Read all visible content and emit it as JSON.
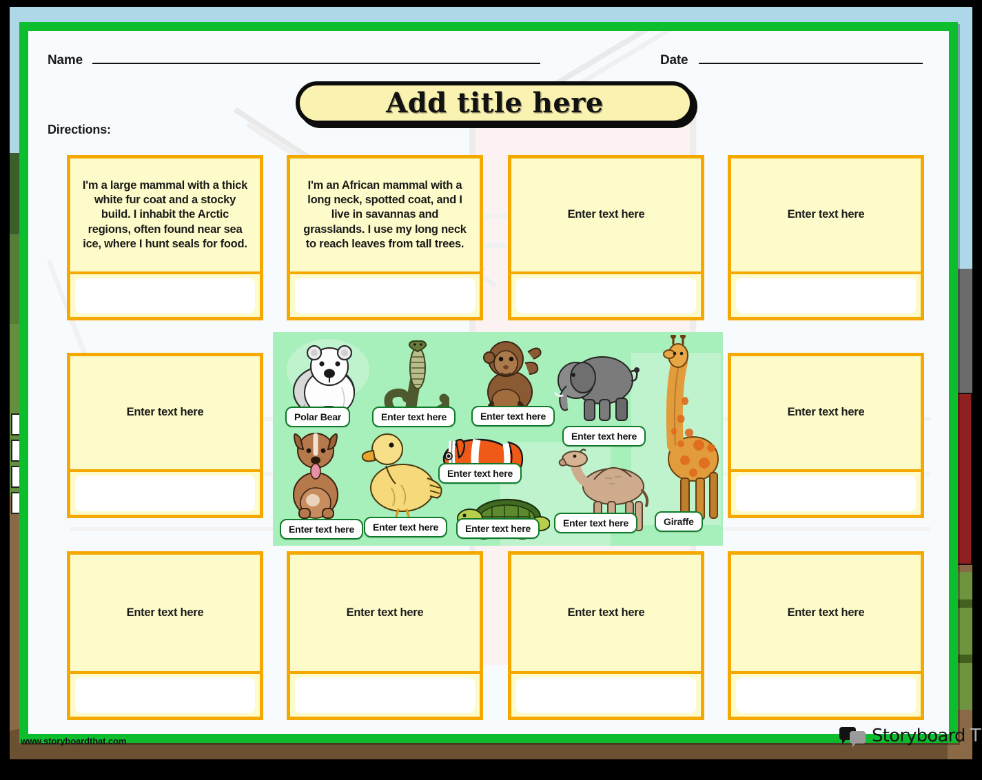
{
  "header": {
    "name_label": "Name",
    "date_label": "Date",
    "title": "Add title here",
    "directions_label": "Directions:"
  },
  "placeholders": {
    "card_text": "Enter text here",
    "tag_text": "Enter text here"
  },
  "cards": [
    {
      "id": "card-1",
      "text": "I'm a large mammal with a thick white fur coat and a stocky build. I inhabit the Arctic regions, often found near sea ice, where I hunt seals for food.",
      "filled": true
    },
    {
      "id": "card-2",
      "text": "I'm an African mammal with a long neck, spotted coat, and I live in savannas and grasslands. I use my long neck to reach leaves from tall trees.",
      "filled": true
    },
    {
      "id": "card-3",
      "text": "Enter text here",
      "filled": false
    },
    {
      "id": "card-4",
      "text": "Enter text here",
      "filled": false
    },
    {
      "id": "card-5",
      "text": "Enter text here",
      "filled": false
    },
    {
      "id": "card-6",
      "text": "Enter text here",
      "filled": false
    },
    {
      "id": "card-7",
      "text": "Enter text here",
      "filled": false
    },
    {
      "id": "card-8",
      "text": "Enter text here",
      "filled": false
    },
    {
      "id": "card-9",
      "text": "Enter text here",
      "filled": false
    },
    {
      "id": "card-10",
      "text": "Enter text here",
      "filled": false
    }
  ],
  "animal_scene": {
    "animals": [
      {
        "name": "polar-bear",
        "label": "Polar Bear",
        "filled": true
      },
      {
        "name": "cobra-snake",
        "label": "Enter text here",
        "filled": false
      },
      {
        "name": "monkey",
        "label": "Enter text here",
        "filled": false
      },
      {
        "name": "elephant",
        "label": "Enter text here",
        "filled": false
      },
      {
        "name": "dog",
        "label": "Enter text here",
        "filled": false
      },
      {
        "name": "duck",
        "label": "Enter text here",
        "filled": false
      },
      {
        "name": "clownfish",
        "label": "Enter text here",
        "filled": false
      },
      {
        "name": "turtle",
        "label": "Enter text here",
        "filled": false
      },
      {
        "name": "camel",
        "label": "Enter text here",
        "filled": false
      },
      {
        "name": "giraffe",
        "label": "Giraffe",
        "filled": true
      }
    ]
  },
  "footer": {
    "site_url": "www.storyboardthat.com",
    "logo_word_1": "Storyboard",
    "logo_word_2": "That"
  },
  "colors": {
    "frame_green": "#0cbe2e",
    "card_border": "#f5a800",
    "card_fill": "#fdfbc9",
    "title_fill": "#faf2b0",
    "panel_green": "#a7efbb",
    "tag_border": "#0f7a2a",
    "sky": "#aed7e8",
    "ground": "#8a6a46"
  }
}
